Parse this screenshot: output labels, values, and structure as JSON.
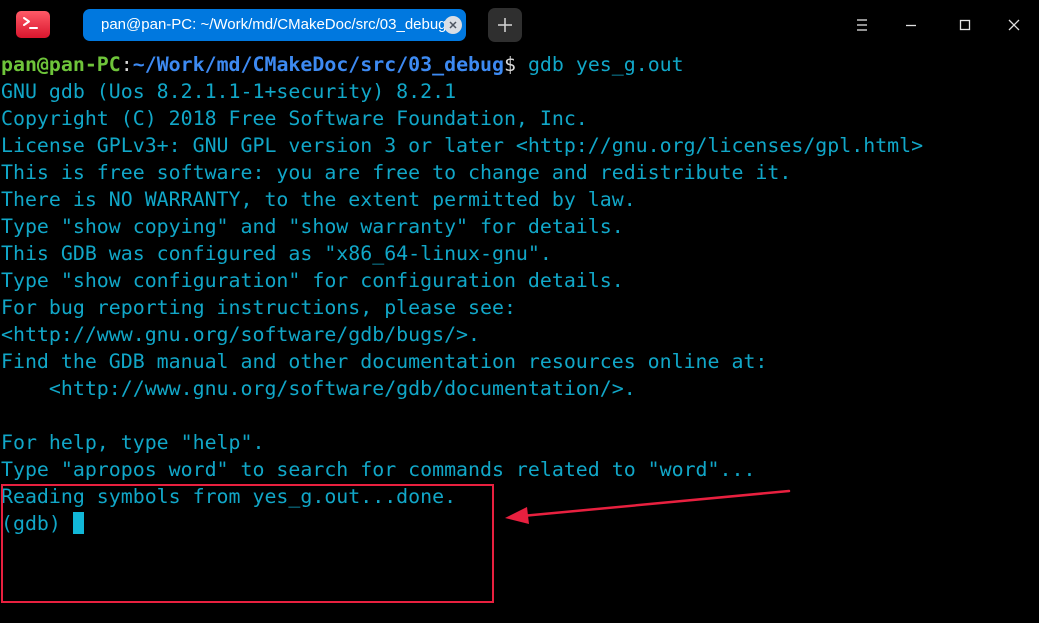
{
  "window": {
    "tab_title": "pan@pan-PC: ~/Work/md/CMakeDoc/src/03_debug"
  },
  "icons": {
    "app": "terminal-app-icon",
    "tab_close": "close-icon",
    "new_tab": "plus-icon",
    "menu": "menu-icon",
    "minimize": "minimize-icon",
    "maximize": "maximize-icon",
    "close": "close-icon"
  },
  "colors": {
    "background": "#000000",
    "text": "#11a7c8",
    "prompt_user": "#6ec43a",
    "prompt_path": "#3d8af2",
    "tab_active": "#0078df",
    "annotation": "#e8203f"
  },
  "terminal": {
    "prompt": {
      "user_host": "pan@pan-PC",
      "separator": ":",
      "path": "~/Work/md/CMakeDoc/src/03_debug",
      "symbol": "$",
      "command": " gdb yes_g.out"
    },
    "lines": [
      "GNU gdb (Uos 8.2.1.1-1+security) 8.2.1",
      "Copyright (C) 2018 Free Software Foundation, Inc.",
      "License GPLv3+: GNU GPL version 3 or later <http://gnu.org/licenses/gpl.html>",
      "This is free software: you are free to change and redistribute it.",
      "There is NO WARRANTY, to the extent permitted by law.",
      "Type \"show copying\" and \"show warranty\" for details.",
      "This GDB was configured as \"x86_64-linux-gnu\".",
      "Type \"show configuration\" for configuration details.",
      "For bug reporting instructions, please see:",
      "<http://www.gnu.org/software/gdb/bugs/>.",
      "Find the GDB manual and other documentation resources online at:",
      "    <http://www.gnu.org/software/gdb/documentation/>.",
      "",
      "For help, type \"help\".",
      "Type \"apropos word\" to search for commands related to \"word\"...",
      "Reading symbols from yes_g.out...done.",
      "(gdb) "
    ]
  }
}
